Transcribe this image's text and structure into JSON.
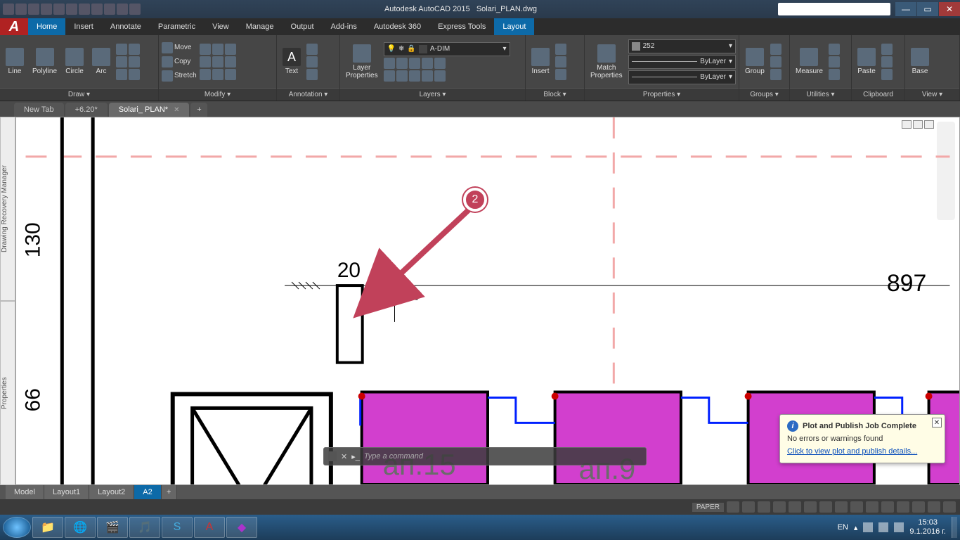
{
  "titlebar": {
    "app": "Autodesk AutoCAD 2015",
    "file": "Solari_PLAN.dwg"
  },
  "ribbonTabs": [
    "Home",
    "Insert",
    "Annotate",
    "Parametric",
    "View",
    "Manage",
    "Output",
    "Add-ins",
    "Autodesk 360",
    "Express Tools",
    "Layout"
  ],
  "activeRibbonTab": "Home",
  "highlightedTab": "Layout",
  "drawPanel": {
    "line": "Line",
    "polyline": "Polyline",
    "circle": "Circle",
    "arc": "Arc",
    "footer": "Draw ▾"
  },
  "modifyPanel": {
    "move": "Move",
    "copy": "Copy",
    "stretch": "Stretch",
    "footer": "Modify ▾"
  },
  "annotationPanel": {
    "text": "Text",
    "footer": "Annotation ▾"
  },
  "layersPanel": {
    "btn": "Layer\nProperties",
    "current": "A-DIM",
    "footer": "Layers ▾"
  },
  "blockPanel": {
    "btn": "Insert",
    "footer": "Block ▾"
  },
  "propsPanel": {
    "match": "Match\nProperties",
    "color": "252",
    "lt1": "ByLayer",
    "lt2": "ByLayer",
    "footer": "Properties ▾"
  },
  "groupsPanel": {
    "btn": "Group",
    "footer": "Groups ▾"
  },
  "utilPanel": {
    "btn": "Measure",
    "footer": "Utilities ▾"
  },
  "clipPanel": {
    "btn": "Paste",
    "footer": "Clipboard"
  },
  "viewPanel": {
    "btn": "Base",
    "footer": "View ▾"
  },
  "drawingTabs": [
    {
      "label": "New Tab",
      "active": false
    },
    {
      "label": "+6.20*",
      "active": false
    },
    {
      "label": "Solari_ PLAN*",
      "active": true
    }
  ],
  "sidePalettes": [
    "Drawing Recovery Manager",
    "Properties"
  ],
  "canvas": {
    "dim130": "130",
    "dim20": "20",
    "dim66": "66",
    "dim897": "897",
    "ap15": "ап.15",
    "ap9": "ап.9",
    "marker": "2"
  },
  "cmd": {
    "placeholder": "Type a command"
  },
  "balloon": {
    "title": "Plot and Publish Job Complete",
    "msg": "No errors or warnings found",
    "link": "Click to view plot and publish details..."
  },
  "layoutTabs": [
    "Model",
    "Layout1",
    "Layout2",
    "A2"
  ],
  "activeLayoutTab": "A2",
  "status": {
    "paper": "PAPER"
  },
  "tray": {
    "lang": "EN",
    "time": "15:03",
    "date": "9.1.2016 г."
  }
}
